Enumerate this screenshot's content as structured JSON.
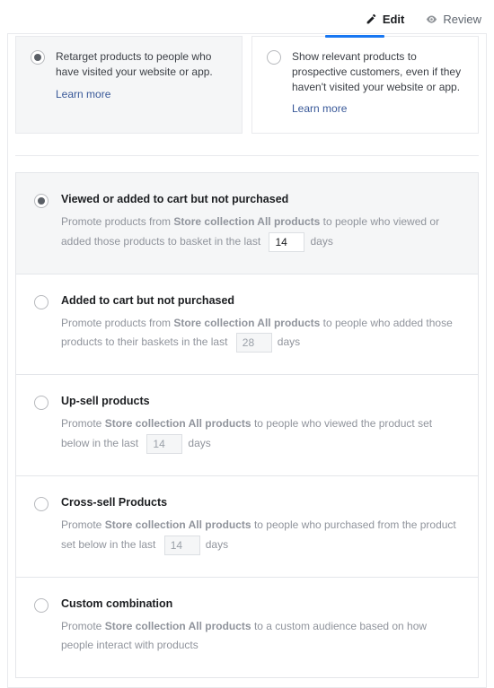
{
  "tabs": {
    "edit": "Edit",
    "review": "Review"
  },
  "topCards": {
    "retarget": {
      "text": "Retarget products to people who have visited your website or app.",
      "learn": "Learn more"
    },
    "prospect": {
      "text": "Show relevant products to prospective customers, even if they haven't visited your website or app.",
      "learn": "Learn more"
    }
  },
  "store": "Store collection All products",
  "options": {
    "viewed": {
      "title": "Viewed or added to cart but not purchased",
      "pre": "Promote products from ",
      "mid": " to people who viewed or added those products to basket in the last ",
      "days": "14",
      "post": "days"
    },
    "added": {
      "title": "Added to cart but not purchased",
      "pre": "Promote products from ",
      "mid": " to people who added those products to their baskets in the last ",
      "days": "28",
      "post": "days"
    },
    "upsell": {
      "title": "Up-sell products",
      "pre": "Promote ",
      "mid": " to people who viewed the product set below in the last ",
      "days": "14",
      "post": "days"
    },
    "cross": {
      "title": "Cross-sell Products",
      "pre": "Promote ",
      "mid": " to people who purchased from the product set below in the last ",
      "days": "14",
      "post": "days"
    },
    "custom": {
      "title": "Custom combination",
      "pre": "Promote ",
      "mid": " to a custom audience based on how people interact with products"
    }
  }
}
